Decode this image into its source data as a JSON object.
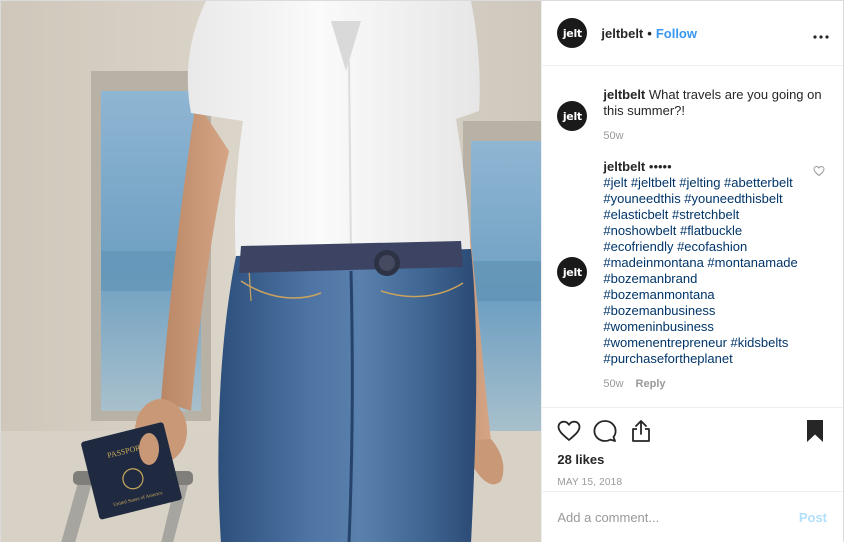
{
  "brand": {
    "accent": "#3897f0",
    "hashtag_color": "#003569",
    "muted": "#999999",
    "avatar_bg": "#1a1a1a"
  },
  "photo": {
    "passport_label": "PASSPORT",
    "passport_sub": "United States of America"
  },
  "header": {
    "avatar_text": "jelt",
    "username": "jeltbelt",
    "separator": "•",
    "follow_label": "Follow",
    "more_icon": "more-horizontal-icon"
  },
  "caption": {
    "avatar_text": "jelt",
    "username": "jeltbelt",
    "text": "What travels are you going on this summer?!",
    "age": "50w"
  },
  "comment": {
    "avatar_text": "jelt",
    "username": "jeltbelt",
    "dots": "•••••",
    "hashtags": [
      "#jelt #jeltbelt #jelting #abetterbelt",
      "#youneedthis #youneedthisbelt",
      "#elasticbelt #stretchbelt",
      "#noshowbelt #flatbuckle",
      "#ecofriendly #ecofashion",
      "#madeinmontana #montanamade",
      "#bozemanbrand",
      "#bozemanmontana",
      "#bozemanbusiness",
      "#womeninbusiness",
      "#womenentrepreneur #kidsbelts",
      "#purchasefortheplanet"
    ],
    "age": "50w",
    "reply_label": "Reply"
  },
  "actions": {
    "icons": [
      "heart-icon",
      "comment-icon",
      "share-icon",
      "bookmark-icon"
    ],
    "likes": "28 likes",
    "date": "MAY 15, 2018"
  },
  "add_comment": {
    "placeholder": "Add a comment...",
    "post_label": "Post"
  }
}
